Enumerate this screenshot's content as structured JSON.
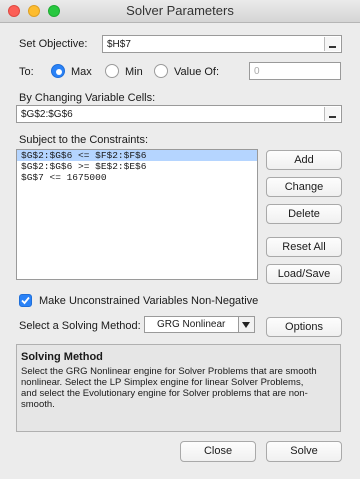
{
  "window": {
    "title": "Solver Parameters"
  },
  "objective": {
    "label": "Set Objective:",
    "value": "$H$7"
  },
  "to": {
    "label": "To:",
    "options": [
      "Max",
      "Min",
      "Value Of:"
    ],
    "selected": "Max",
    "value_of": "0"
  },
  "changing": {
    "label": "By Changing Variable Cells:",
    "value": "$G$2:$G$6"
  },
  "constraints": {
    "label": "Subject to the Constraints:",
    "items": [
      "$G$2:$G$6 <= $F$2:$F$6",
      "$G$2:$G$6 >= $E$2:$E$6",
      "$G$7 <= 1675000"
    ],
    "selected_index": 0
  },
  "constraint_buttons": {
    "add": "Add",
    "change": "Change",
    "delete": "Delete",
    "reset_all": "Reset All",
    "load_save": "Load/Save"
  },
  "nonneg": {
    "label": "Make Unconstrained Variables Non-Negative",
    "checked": true
  },
  "method": {
    "label": "Select a Solving Method:",
    "selected": "GRG Nonlinear",
    "options_button": "Options"
  },
  "solving_method": {
    "title": "Solving Method",
    "lines": [
      "Select the GRG Nonlinear engine for Solver Problems that are smooth",
      "nonlinear. Select the LP Simplex engine for linear Solver Problems,",
      "and select the Evolutionary engine for Solver problems that are non-",
      "smooth."
    ]
  },
  "footer": {
    "close": "Close",
    "solve": "Solve"
  },
  "colors": {
    "accent": "#2a82f7",
    "selection": "#b5d5ff"
  }
}
